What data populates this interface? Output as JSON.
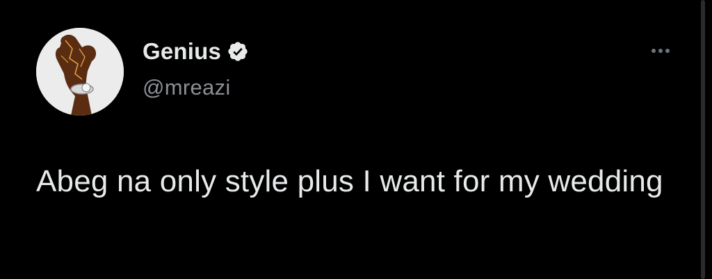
{
  "tweet": {
    "author": {
      "display_name": "Genius",
      "handle": "@mreazi",
      "verified": true,
      "avatar": "hand-with-watch-avatar"
    },
    "text": "Abeg na only style plus I want for my wedding",
    "more_icon": "ellipsis-icon"
  },
  "colors": {
    "background": "#000000",
    "text_primary": "#e7e9ea",
    "text_secondary": "#8b9096",
    "verified_badge": "#e7e9ea"
  }
}
